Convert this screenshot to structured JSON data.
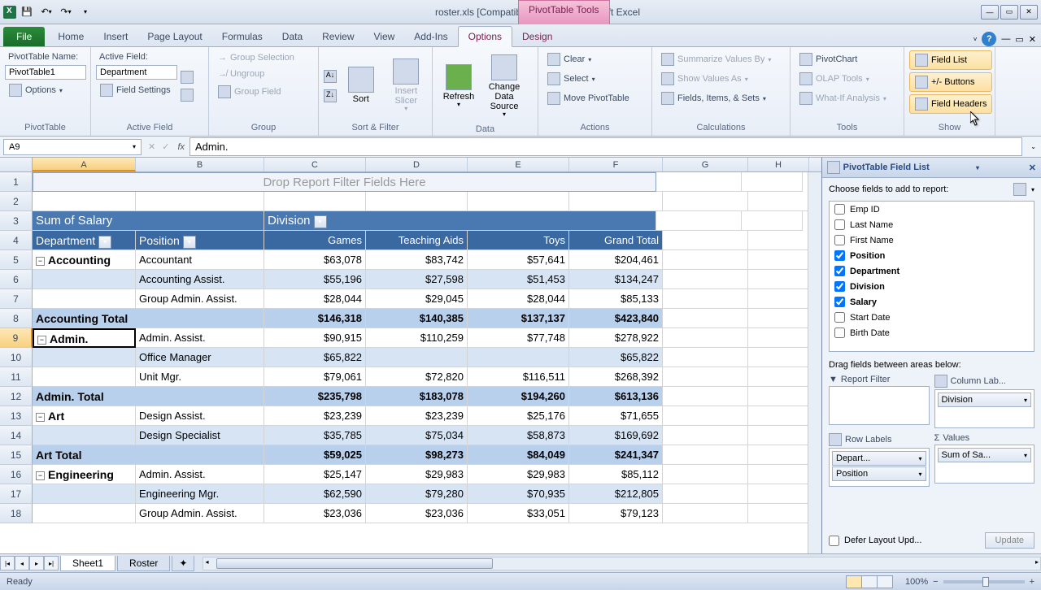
{
  "title": "roster.xls  [Compatibility Mode] - Microsoft Excel",
  "contextual_title": "PivotTable Tools",
  "tabs": {
    "file": "File",
    "home": "Home",
    "insert": "Insert",
    "layout": "Page Layout",
    "formulas": "Formulas",
    "data": "Data",
    "review": "Review",
    "view": "View",
    "addins": "Add-Ins",
    "options": "Options",
    "design": "Design"
  },
  "ribbon": {
    "pt_name_label": "PivotTable Name:",
    "pt_name": "PivotTable1",
    "options_btn": "Options",
    "active_field_label": "Active Field:",
    "active_field": "Department",
    "field_settings": "Field Settings",
    "group_selection": "Group Selection",
    "ungroup": "Ungroup",
    "group_field": "Group Field",
    "sort": "Sort",
    "insert_slicer": "Insert Slicer",
    "refresh": "Refresh",
    "change_source": "Change Data Source",
    "clear": "Clear",
    "select": "Select",
    "move": "Move PivotTable",
    "summarize": "Summarize Values By",
    "show_as": "Show Values As",
    "fields_items": "Fields, Items, & Sets",
    "pivotchart": "PivotChart",
    "olap": "OLAP Tools",
    "whatif": "What-If Analysis",
    "field_list": "Field List",
    "pm_buttons": "+/- Buttons",
    "field_headers": "Field Headers",
    "g1": "PivotTable",
    "g2": "Active Field",
    "g3": "Group",
    "g4": "Sort & Filter",
    "g5": "Data",
    "g6": "Actions",
    "g7": "Calculations",
    "g8": "Tools",
    "g9": "Show"
  },
  "name_box": "A9",
  "formula": "Admin.",
  "cols": [
    "A",
    "B",
    "C",
    "D",
    "E",
    "F",
    "G",
    "H"
  ],
  "pivot": {
    "drop_hint": "Drop Report Filter Fields Here",
    "measure": "Sum of Salary",
    "col_field": "Division",
    "row_field1": "Department",
    "row_field2": "Position",
    "col_labels": [
      "Games",
      "Teaching Aids",
      "Toys",
      "Grand Total"
    ]
  },
  "rows": [
    {
      "n": 5,
      "a": "Accounting",
      "b": "Accountant",
      "v": [
        "$63,078",
        "$83,742",
        "$57,641",
        "$204,461"
      ],
      "group": true,
      "band": false
    },
    {
      "n": 6,
      "a": "",
      "b": "Accounting Assist.",
      "v": [
        "$55,196",
        "$27,598",
        "$51,453",
        "$134,247"
      ],
      "band": true
    },
    {
      "n": 7,
      "a": "",
      "b": "Group Admin. Assist.",
      "v": [
        "$28,044",
        "$29,045",
        "$28,044",
        "$85,133"
      ],
      "band": false
    },
    {
      "n": 8,
      "a": "Accounting Total",
      "b": "",
      "v": [
        "$146,318",
        "$140,385",
        "$137,137",
        "$423,840"
      ],
      "total": true
    },
    {
      "n": 9,
      "a": "Admin.",
      "b": "Admin. Assist.",
      "v": [
        "$90,915",
        "$110,259",
        "$77,748",
        "$278,922"
      ],
      "group": true,
      "band": false,
      "active": true
    },
    {
      "n": 10,
      "a": "",
      "b": "Office Manager",
      "v": [
        "$65,822",
        "",
        "",
        "$65,822"
      ],
      "band": true
    },
    {
      "n": 11,
      "a": "",
      "b": "Unit Mgr.",
      "v": [
        "$79,061",
        "$72,820",
        "$116,511",
        "$268,392"
      ],
      "band": false
    },
    {
      "n": 12,
      "a": "Admin. Total",
      "b": "",
      "v": [
        "$235,798",
        "$183,078",
        "$194,260",
        "$613,136"
      ],
      "total": true
    },
    {
      "n": 13,
      "a": "Art",
      "b": "Design Assist.",
      "v": [
        "$23,239",
        "$23,239",
        "$25,176",
        "$71,655"
      ],
      "group": true,
      "band": false
    },
    {
      "n": 14,
      "a": "",
      "b": "Design Specialist",
      "v": [
        "$35,785",
        "$75,034",
        "$58,873",
        "$169,692"
      ],
      "band": true
    },
    {
      "n": 15,
      "a": "Art Total",
      "b": "",
      "v": [
        "$59,025",
        "$98,273",
        "$84,049",
        "$241,347"
      ],
      "total": true
    },
    {
      "n": 16,
      "a": "Engineering",
      "b": "Admin. Assist.",
      "v": [
        "$25,147",
        "$29,983",
        "$29,983",
        "$85,112"
      ],
      "group": true,
      "band": false
    },
    {
      "n": 17,
      "a": "",
      "b": "Engineering Mgr.",
      "v": [
        "$62,590",
        "$79,280",
        "$70,935",
        "$212,805"
      ],
      "band": true
    },
    {
      "n": 18,
      "a": "",
      "b": "Group Admin. Assist.",
      "v": [
        "$23,036",
        "$23,036",
        "$33,051",
        "$79,123"
      ],
      "band": false
    }
  ],
  "field_list": {
    "title": "PivotTable Field List",
    "subtitle": "Choose fields to add to report:",
    "fields": [
      {
        "name": "Emp ID",
        "checked": false
      },
      {
        "name": "Last Name",
        "checked": false
      },
      {
        "name": "First Name",
        "checked": false
      },
      {
        "name": "Position",
        "checked": true
      },
      {
        "name": "Department",
        "checked": true
      },
      {
        "name": "Division",
        "checked": true
      },
      {
        "name": "Salary",
        "checked": true
      },
      {
        "name": "Start Date",
        "checked": false
      },
      {
        "name": "Birth Date",
        "checked": false
      }
    ],
    "drag_label": "Drag fields between areas below:",
    "areas": {
      "filter": "Report Filter",
      "columns": "Column Lab...",
      "rows": "Row Labels",
      "values": "Values"
    },
    "col_items": [
      "Division"
    ],
    "row_items": [
      "Depart...",
      "Position"
    ],
    "val_items": [
      "Sum of Sa..."
    ],
    "defer": "Defer Layout Upd...",
    "update": "Update"
  },
  "sheets": [
    "Sheet1",
    "Roster"
  ],
  "status": "Ready",
  "zoom": "100%"
}
